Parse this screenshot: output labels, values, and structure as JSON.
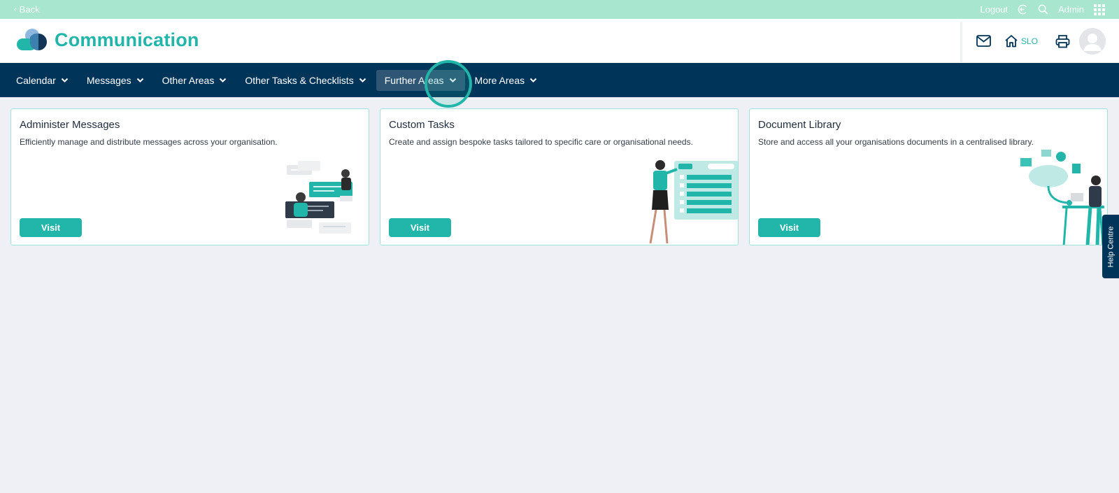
{
  "topbar": {
    "back_label": "Back",
    "logout_label": "Logout",
    "user_label": "Admin"
  },
  "header": {
    "title": "Communication",
    "home_label": "SLO"
  },
  "nav": {
    "items": [
      {
        "label": "Calendar"
      },
      {
        "label": "Messages"
      },
      {
        "label": "Other Areas"
      },
      {
        "label": "Other Tasks & Checklists"
      },
      {
        "label": "Further Areas",
        "active": true
      },
      {
        "label": "More Areas"
      }
    ]
  },
  "cards": [
    {
      "title": "Administer Messages",
      "description": "Efficiently manage and distribute messages across your organisation.",
      "button": "Visit"
    },
    {
      "title": "Custom Tasks",
      "description": "Create and assign bespoke tasks tailored to specific care or organisational needs.",
      "button": "Visit"
    },
    {
      "title": "Document Library",
      "description": "Store and access all your organisations documents in a centralised library.",
      "button": "Visit"
    }
  ],
  "help_tab": {
    "label": "Help Centre"
  },
  "colors": {
    "accent": "#22b5a9",
    "topbar": "#a8e6cf",
    "nav": "#003458",
    "nav_active": "#2f5674",
    "page_bg": "#eff0f5"
  },
  "icons": [
    "chevron-left-icon",
    "logout-icon",
    "search-icon",
    "apps-grid-icon",
    "mail-icon",
    "home-icon",
    "printer-icon",
    "user-avatar-icon",
    "chevron-down-icon"
  ]
}
